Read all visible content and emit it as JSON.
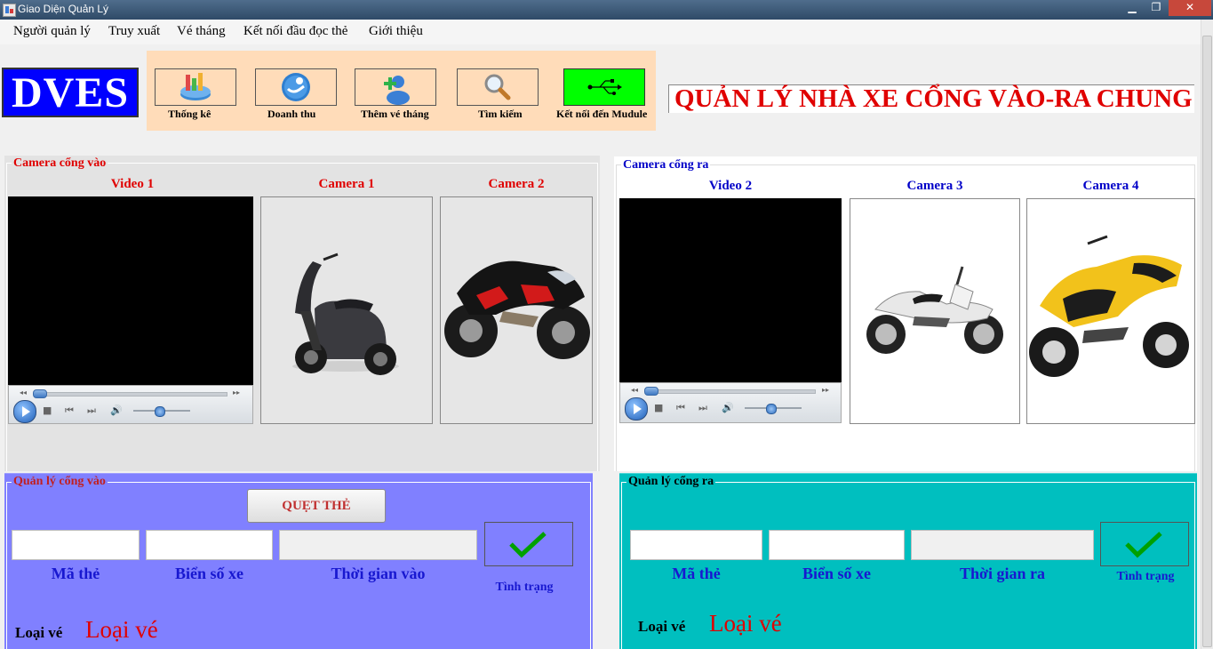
{
  "window": {
    "title": "Giao Diện Quản Lý",
    "minimize": "▁",
    "maximize": "❐",
    "close": "✕"
  },
  "menu": [
    "Người quản lý",
    "Truy xuất",
    "Vé tháng",
    "Kết nối đầu đọc thẻ",
    "Giới thiệu"
  ],
  "logo": "DVES",
  "toolbar": [
    {
      "label": "Thống kê",
      "icon": "chart-icon"
    },
    {
      "label": "Doanh thu",
      "icon": "revenue-icon"
    },
    {
      "label": "Thêm vé tháng",
      "icon": "add-user-icon"
    },
    {
      "label": "Tìm kiếm",
      "icon": "search-icon"
    },
    {
      "label": "Kết nối đến Mudule",
      "icon": "usb-icon"
    }
  ],
  "header_title": "QUẢN LÝ NHÀ XE CỔNG VÀO-RA CHUNG",
  "camera_in": {
    "legend": "Camera cổng vào",
    "video_label": "Video 1",
    "cam_a_label": "Camera 1",
    "cam_b_label": "Camera 2"
  },
  "camera_out": {
    "legend": "Camera cổng ra",
    "video_label": "Video 2",
    "cam_a_label": "Camera 3",
    "cam_b_label": "Camera 4"
  },
  "manage_in": {
    "legend": "Quản lý cổng vào",
    "swipe_button": "QUẸT THẺ",
    "card_label": "Mã thẻ",
    "plate_label": "Biển số xe",
    "time_label": "Thời gian vào",
    "status_label": "Tình trạng",
    "ticket_type_label": "Loại vé",
    "ticket_type_value": "Loại vé"
  },
  "manage_out": {
    "legend": "Quản lý cổng ra",
    "card_label": "Mã thẻ",
    "plate_label": "Biển số xe",
    "time_label": "Thời gian ra",
    "status_label": "Tình trạng",
    "ticket_type_label": "Loại vé",
    "ticket_type_value": "Loại vé"
  },
  "colors": {
    "logo_bg": "#0000ff",
    "toolbar_bg": "#ffdcb9",
    "title_red": "#e00000",
    "in_panel": "#8080ff",
    "out_panel": "#00bfbf",
    "usb_button": "#00ff00",
    "check_green": "#00a000"
  }
}
